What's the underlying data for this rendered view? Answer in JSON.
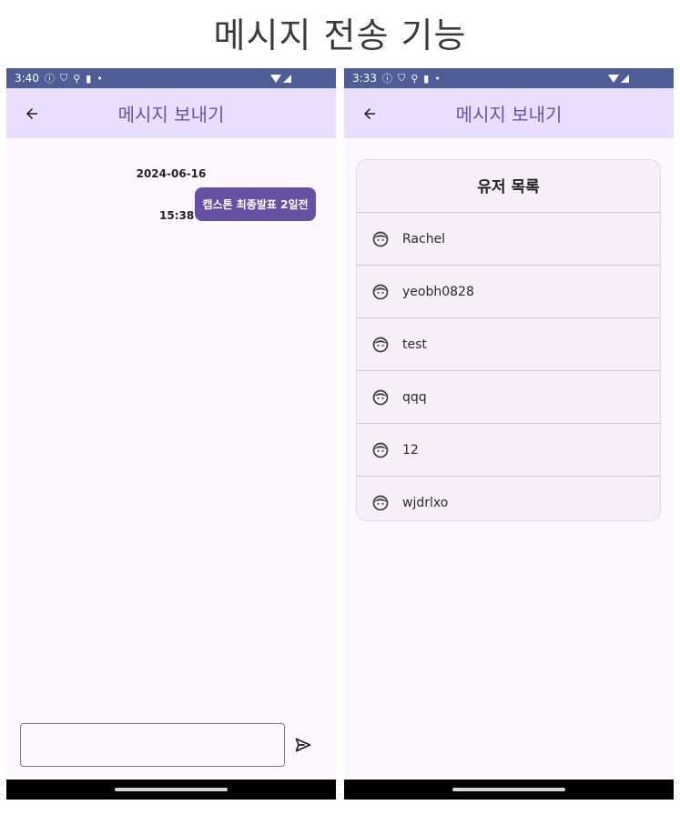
{
  "title": "메시지 전송 기능",
  "screens": {
    "chat": {
      "status_time": "3:40",
      "app_bar_title": "메시지 보내기",
      "date": "2024-06-16",
      "messages": [
        {
          "text": "캡스톤 최종발표 2일전",
          "time": "15:38"
        }
      ],
      "input_value": "",
      "icons": {
        "back": "arrow-back-icon",
        "send": "send-icon"
      }
    },
    "users": {
      "status_time": "3:33",
      "app_bar_title": "메시지 보내기",
      "card_title": "유저 목록",
      "users": [
        "Rachel",
        "yeobh0828",
        "test",
        "qqq",
        "12",
        "wjdrlxo"
      ],
      "icons": {
        "back": "arrow-back-icon",
        "user": "face-icon"
      }
    }
  },
  "colors": {
    "status_bar": "#4e5d96",
    "app_bar": "#e9defe",
    "title_accent": "#6a54a8",
    "bubble": "#6750a4",
    "background": "#fdf7ff"
  }
}
